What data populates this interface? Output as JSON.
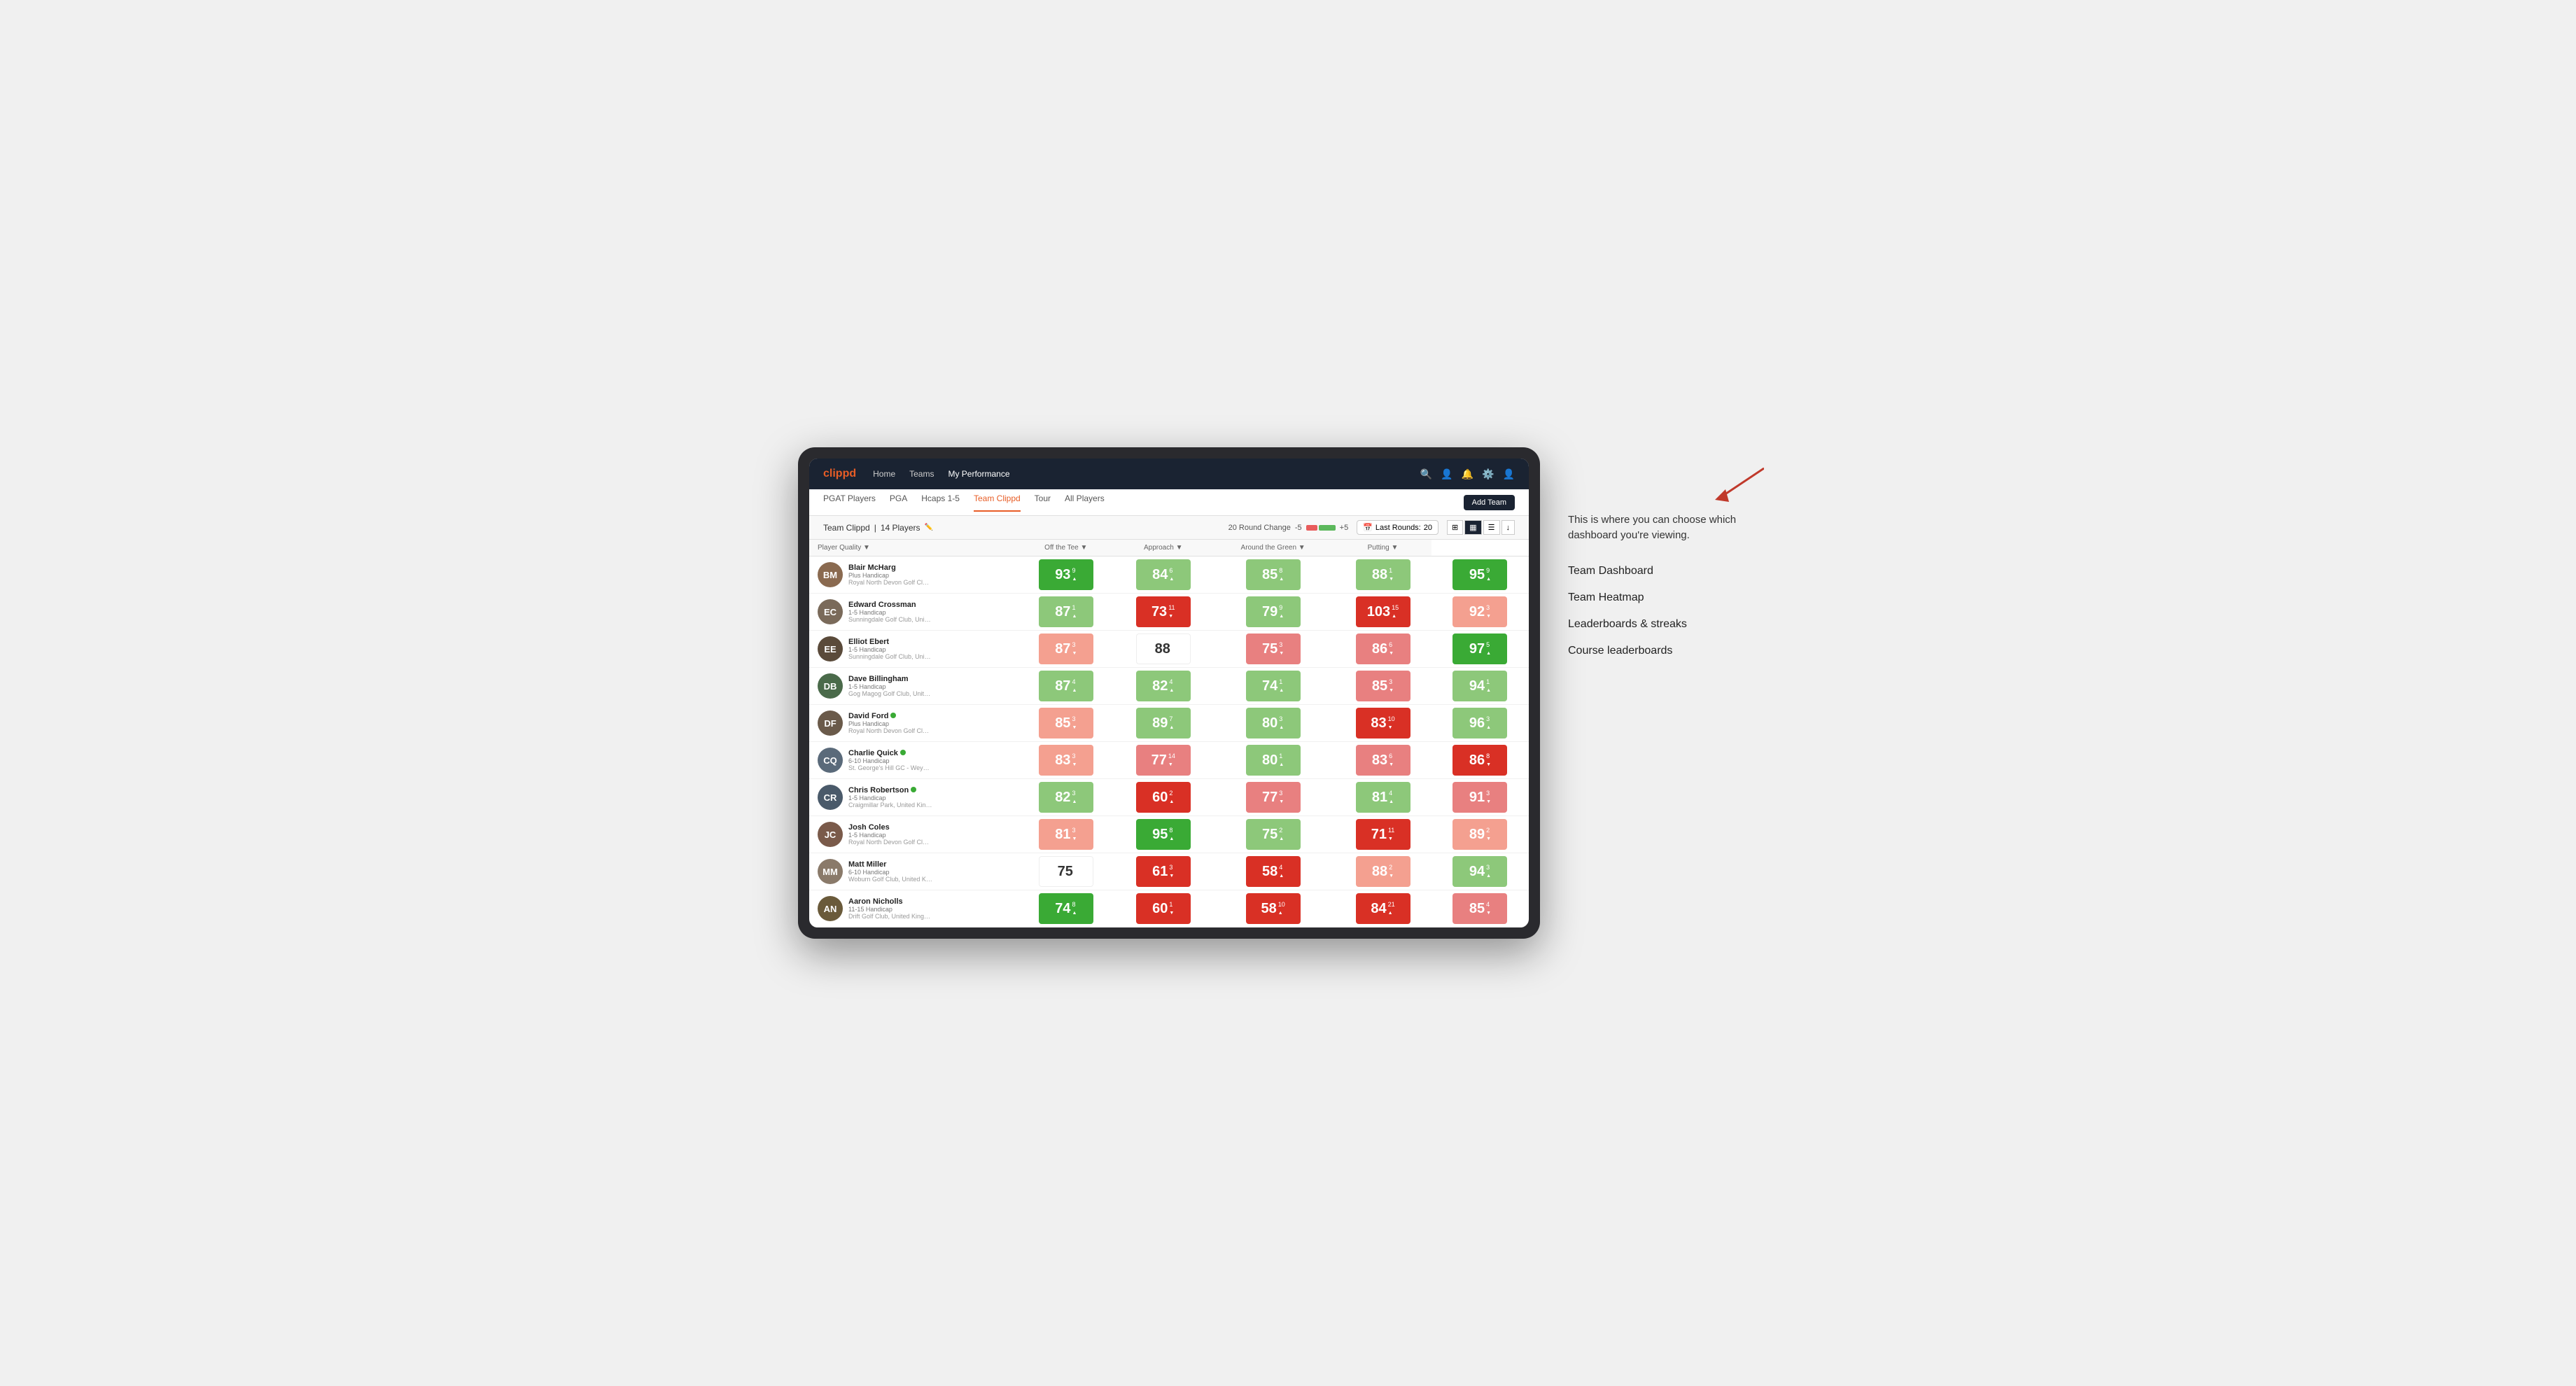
{
  "annotation": {
    "intro_text": "This is where you can choose which dashboard you're viewing.",
    "items": [
      "Team Dashboard",
      "Team Heatmap",
      "Leaderboards & streaks",
      "Course leaderboards"
    ]
  },
  "nav": {
    "logo": "clippd",
    "links": [
      {
        "label": "Home",
        "active": false
      },
      {
        "label": "Teams",
        "active": false
      },
      {
        "label": "My Performance",
        "active": true
      }
    ],
    "icons": [
      "search",
      "person",
      "bell",
      "settings",
      "avatar"
    ]
  },
  "sub_nav": {
    "links": [
      {
        "label": "PGAT Players",
        "active": false
      },
      {
        "label": "PGA",
        "active": false
      },
      {
        "label": "Hcaps 1-5",
        "active": false
      },
      {
        "label": "Team Clippd",
        "active": true
      },
      {
        "label": "Tour",
        "active": false
      },
      {
        "label": "All Players",
        "active": false
      }
    ],
    "add_team_label": "Add Team"
  },
  "team_header": {
    "title": "Team Clippd",
    "count": "14 Players",
    "round_change_label": "20 Round Change",
    "neg_label": "-5",
    "pos_label": "+5",
    "last_rounds_label": "Last Rounds:",
    "last_rounds_value": "20"
  },
  "table": {
    "columns": [
      {
        "label": "Player Quality ▼",
        "key": "player_quality"
      },
      {
        "label": "Off the Tee ▼",
        "key": "off_tee"
      },
      {
        "label": "Approach ▼",
        "key": "approach"
      },
      {
        "label": "Around the Green ▼",
        "key": "around_green"
      },
      {
        "label": "Putting ▼",
        "key": "putting"
      }
    ],
    "rows": [
      {
        "name": "Blair McHarg",
        "handicap": "Plus Handicap",
        "club": "Royal North Devon Golf Club, United Kingdom",
        "avatar_color": "#8a6a50",
        "player_quality": {
          "score": "93",
          "change": "9",
          "direction": "up",
          "color": "green-dark"
        },
        "off_tee": {
          "score": "84",
          "change": "6",
          "direction": "up",
          "color": "green-light"
        },
        "approach": {
          "score": "85",
          "change": "8",
          "direction": "up",
          "color": "green-light"
        },
        "around_green": {
          "score": "88",
          "change": "1",
          "direction": "down",
          "color": "green-light"
        },
        "putting": {
          "score": "95",
          "change": "9",
          "direction": "up",
          "color": "green-dark"
        }
      },
      {
        "name": "Edward Crossman",
        "handicap": "1-5 Handicap",
        "club": "Sunningdale Golf Club, United Kingdom",
        "avatar_color": "#7a6a5a",
        "player_quality": {
          "score": "87",
          "change": "1",
          "direction": "up",
          "color": "green-light"
        },
        "off_tee": {
          "score": "73",
          "change": "11",
          "direction": "down",
          "color": "red-dark"
        },
        "approach": {
          "score": "79",
          "change": "9",
          "direction": "up",
          "color": "green-light"
        },
        "around_green": {
          "score": "103",
          "change": "15",
          "direction": "up",
          "color": "red-dark"
        },
        "putting": {
          "score": "92",
          "change": "3",
          "direction": "down",
          "color": "salmon"
        }
      },
      {
        "name": "Elliot Ebert",
        "handicap": "1-5 Handicap",
        "club": "Sunningdale Golf Club, United Kingdom",
        "avatar_color": "#5a4a3a",
        "player_quality": {
          "score": "87",
          "change": "3",
          "direction": "down",
          "color": "salmon"
        },
        "off_tee": {
          "score": "88",
          "change": "",
          "direction": "none",
          "color": "white"
        },
        "approach": {
          "score": "75",
          "change": "3",
          "direction": "down",
          "color": "red-light"
        },
        "around_green": {
          "score": "86",
          "change": "6",
          "direction": "down",
          "color": "red-light"
        },
        "putting": {
          "score": "97",
          "change": "5",
          "direction": "up",
          "color": "green-dark"
        }
      },
      {
        "name": "Dave Billingham",
        "handicap": "1-5 Handicap",
        "club": "Gog Magog Golf Club, United Kingdom",
        "avatar_color": "#4a6a4a",
        "player_quality": {
          "score": "87",
          "change": "4",
          "direction": "up",
          "color": "green-light"
        },
        "off_tee": {
          "score": "82",
          "change": "4",
          "direction": "up",
          "color": "green-light"
        },
        "approach": {
          "score": "74",
          "change": "1",
          "direction": "up",
          "color": "green-light"
        },
        "around_green": {
          "score": "85",
          "change": "3",
          "direction": "down",
          "color": "red-light"
        },
        "putting": {
          "score": "94",
          "change": "1",
          "direction": "up",
          "color": "green-light"
        }
      },
      {
        "name": "David Ford",
        "handicap": "Plus Handicap",
        "club": "Royal North Devon Golf Club, United Kingdom",
        "avatar_color": "#6a5a4a",
        "verified": true,
        "player_quality": {
          "score": "85",
          "change": "3",
          "direction": "down",
          "color": "salmon"
        },
        "off_tee": {
          "score": "89",
          "change": "7",
          "direction": "up",
          "color": "green-light"
        },
        "approach": {
          "score": "80",
          "change": "3",
          "direction": "up",
          "color": "green-light"
        },
        "around_green": {
          "score": "83",
          "change": "10",
          "direction": "down",
          "color": "red-dark"
        },
        "putting": {
          "score": "96",
          "change": "3",
          "direction": "up",
          "color": "green-light"
        }
      },
      {
        "name": "Charlie Quick",
        "handicap": "6-10 Handicap",
        "club": "St. George's Hill GC - Weybridge - Surrey, Uni...",
        "avatar_color": "#5a6a7a",
        "verified": true,
        "player_quality": {
          "score": "83",
          "change": "3",
          "direction": "down",
          "color": "salmon"
        },
        "off_tee": {
          "score": "77",
          "change": "14",
          "direction": "down",
          "color": "red-light"
        },
        "approach": {
          "score": "80",
          "change": "1",
          "direction": "up",
          "color": "green-light"
        },
        "around_green": {
          "score": "83",
          "change": "6",
          "direction": "down",
          "color": "red-light"
        },
        "putting": {
          "score": "86",
          "change": "8",
          "direction": "down",
          "color": "red-dark"
        }
      },
      {
        "name": "Chris Robertson",
        "handicap": "1-5 Handicap",
        "club": "Craigmillar Park, United Kingdom",
        "avatar_color": "#4a5a6a",
        "verified": true,
        "player_quality": {
          "score": "82",
          "change": "3",
          "direction": "up",
          "color": "green-light"
        },
        "off_tee": {
          "score": "60",
          "change": "2",
          "direction": "up",
          "color": "red-dark"
        },
        "approach": {
          "score": "77",
          "change": "3",
          "direction": "down",
          "color": "red-light"
        },
        "around_green": {
          "score": "81",
          "change": "4",
          "direction": "up",
          "color": "green-light"
        },
        "putting": {
          "score": "91",
          "change": "3",
          "direction": "down",
          "color": "red-light"
        }
      },
      {
        "name": "Josh Coles",
        "handicap": "1-5 Handicap",
        "club": "Royal North Devon Golf Club, United Kingdom",
        "avatar_color": "#7a5a4a",
        "player_quality": {
          "score": "81",
          "change": "3",
          "direction": "down",
          "color": "salmon"
        },
        "off_tee": {
          "score": "95",
          "change": "8",
          "direction": "up",
          "color": "green-dark"
        },
        "approach": {
          "score": "75",
          "change": "2",
          "direction": "up",
          "color": "green-light"
        },
        "around_green": {
          "score": "71",
          "change": "11",
          "direction": "down",
          "color": "red-dark"
        },
        "putting": {
          "score": "89",
          "change": "2",
          "direction": "down",
          "color": "salmon"
        }
      },
      {
        "name": "Matt Miller",
        "handicap": "6-10 Handicap",
        "club": "Woburn Golf Club, United Kingdom",
        "avatar_color": "#8a7a6a",
        "player_quality": {
          "score": "75",
          "change": "",
          "direction": "none",
          "color": "white"
        },
        "off_tee": {
          "score": "61",
          "change": "3",
          "direction": "down",
          "color": "red-dark"
        },
        "approach": {
          "score": "58",
          "change": "4",
          "direction": "up",
          "color": "red-dark"
        },
        "around_green": {
          "score": "88",
          "change": "2",
          "direction": "down",
          "color": "salmon"
        },
        "putting": {
          "score": "94",
          "change": "3",
          "direction": "up",
          "color": "green-light"
        }
      },
      {
        "name": "Aaron Nicholls",
        "handicap": "11-15 Handicap",
        "club": "Drift Golf Club, United Kingdom",
        "avatar_color": "#6a5a3a",
        "player_quality": {
          "score": "74",
          "change": "8",
          "direction": "up",
          "color": "green-dark"
        },
        "off_tee": {
          "score": "60",
          "change": "1",
          "direction": "down",
          "color": "red-dark"
        },
        "approach": {
          "score": "58",
          "change": "10",
          "direction": "up",
          "color": "red-dark"
        },
        "around_green": {
          "score": "84",
          "change": "21",
          "direction": "up",
          "color": "red-dark"
        },
        "putting": {
          "score": "85",
          "change": "4",
          "direction": "down",
          "color": "red-light"
        }
      }
    ]
  }
}
